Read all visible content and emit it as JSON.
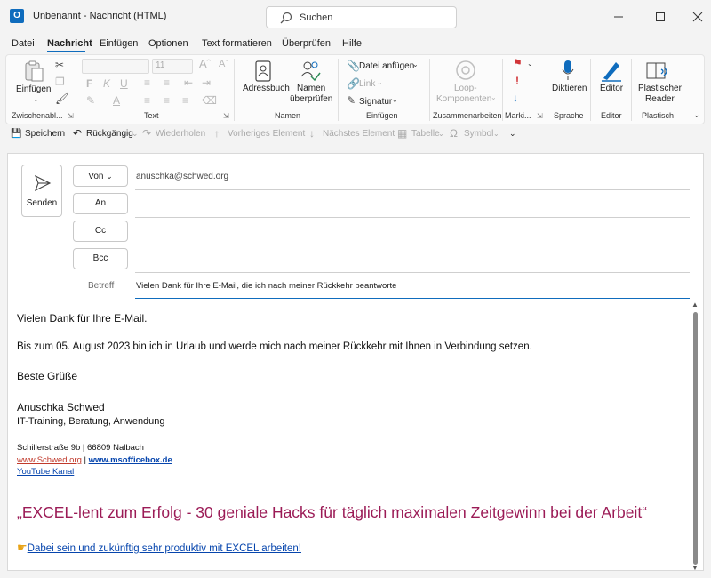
{
  "window": {
    "title": "Unbenannt  -  Nachricht (HTML)",
    "app_icon": "outlook-icon",
    "search_placeholder": "Suchen"
  },
  "menu": {
    "tabs": [
      "Datei",
      "Nachricht",
      "Einfügen",
      "Optionen",
      "Text formatieren",
      "Überprüfen",
      "Hilfe"
    ],
    "active": "Nachricht"
  },
  "ribbon": {
    "paste": "Einfügen",
    "font_size": "11",
    "groups": {
      "clipboard": "Zwischenabl...",
      "text": "Text",
      "names": "Namen",
      "insert": "Einfügen",
      "collab": "Zusammenarbeiten",
      "mark": "Marki...",
      "voice": "Sprache",
      "editor": "Editor",
      "reader": "Plastisch"
    },
    "addressbook": "Adressbuch",
    "check_names_1": "Namen",
    "check_names_2": "überprüfen",
    "attach_file": "Datei anfügen",
    "link": "Link",
    "signature": "Signatur",
    "loop_1": "Loop-",
    "loop_2": "Komponenten",
    "dictate": "Diktieren",
    "editor": "Editor",
    "reader_1": "Plastischer",
    "reader_2": "Reader"
  },
  "qat": {
    "save": "Speichern",
    "undo": "Rückgängig",
    "redo": "Wiederholen",
    "prev": "Vorheriges Element",
    "next": "Nächstes Element",
    "table": "Tabelle",
    "symbol": "Symbol"
  },
  "compose": {
    "send": "Senden",
    "from_label": "Von",
    "from_value": "anuschka@schwed.org",
    "to_label": "An",
    "cc_label": "Cc",
    "bcc_label": "Bcc",
    "subject_label": "Betreff",
    "subject_value": "Vielen Dank für Ihre E-Mail, die ich nach meiner Rückkehr beantworte"
  },
  "body": {
    "line1": "Vielen Dank für Ihre E-Mail.",
    "line2": "Bis zum 05. August 2023 bin ich in Urlaub und werde mich nach meiner Rückkehr mit Ihnen in Verbindung setzen.",
    "greeting": "Beste Grüße",
    "name": "Anuschka Schwed",
    "tagline": "IT-Training, Beratung, Anwendung",
    "address": "Schillerstraße 9b | 66809 Nalbach",
    "link1": "www.Schwed.org",
    "link_sep": " | ",
    "link2": "www.msofficebox.de",
    "youtube": "YouTube Kanal",
    "headline": "„EXCEL-lent zum Erfolg - 30 geniale Hacks für täglich maximalen Zeitgewinn bei der Arbeit“",
    "cta": "Dabei sein und zukünftig sehr produktiv mit EXCEL arbeiten!"
  },
  "colors": {
    "accent": "#0f6cbd",
    "headline": "#9b1b56",
    "link": "#0645ad",
    "link_red": "#c0392b",
    "flag": "#d13438"
  }
}
